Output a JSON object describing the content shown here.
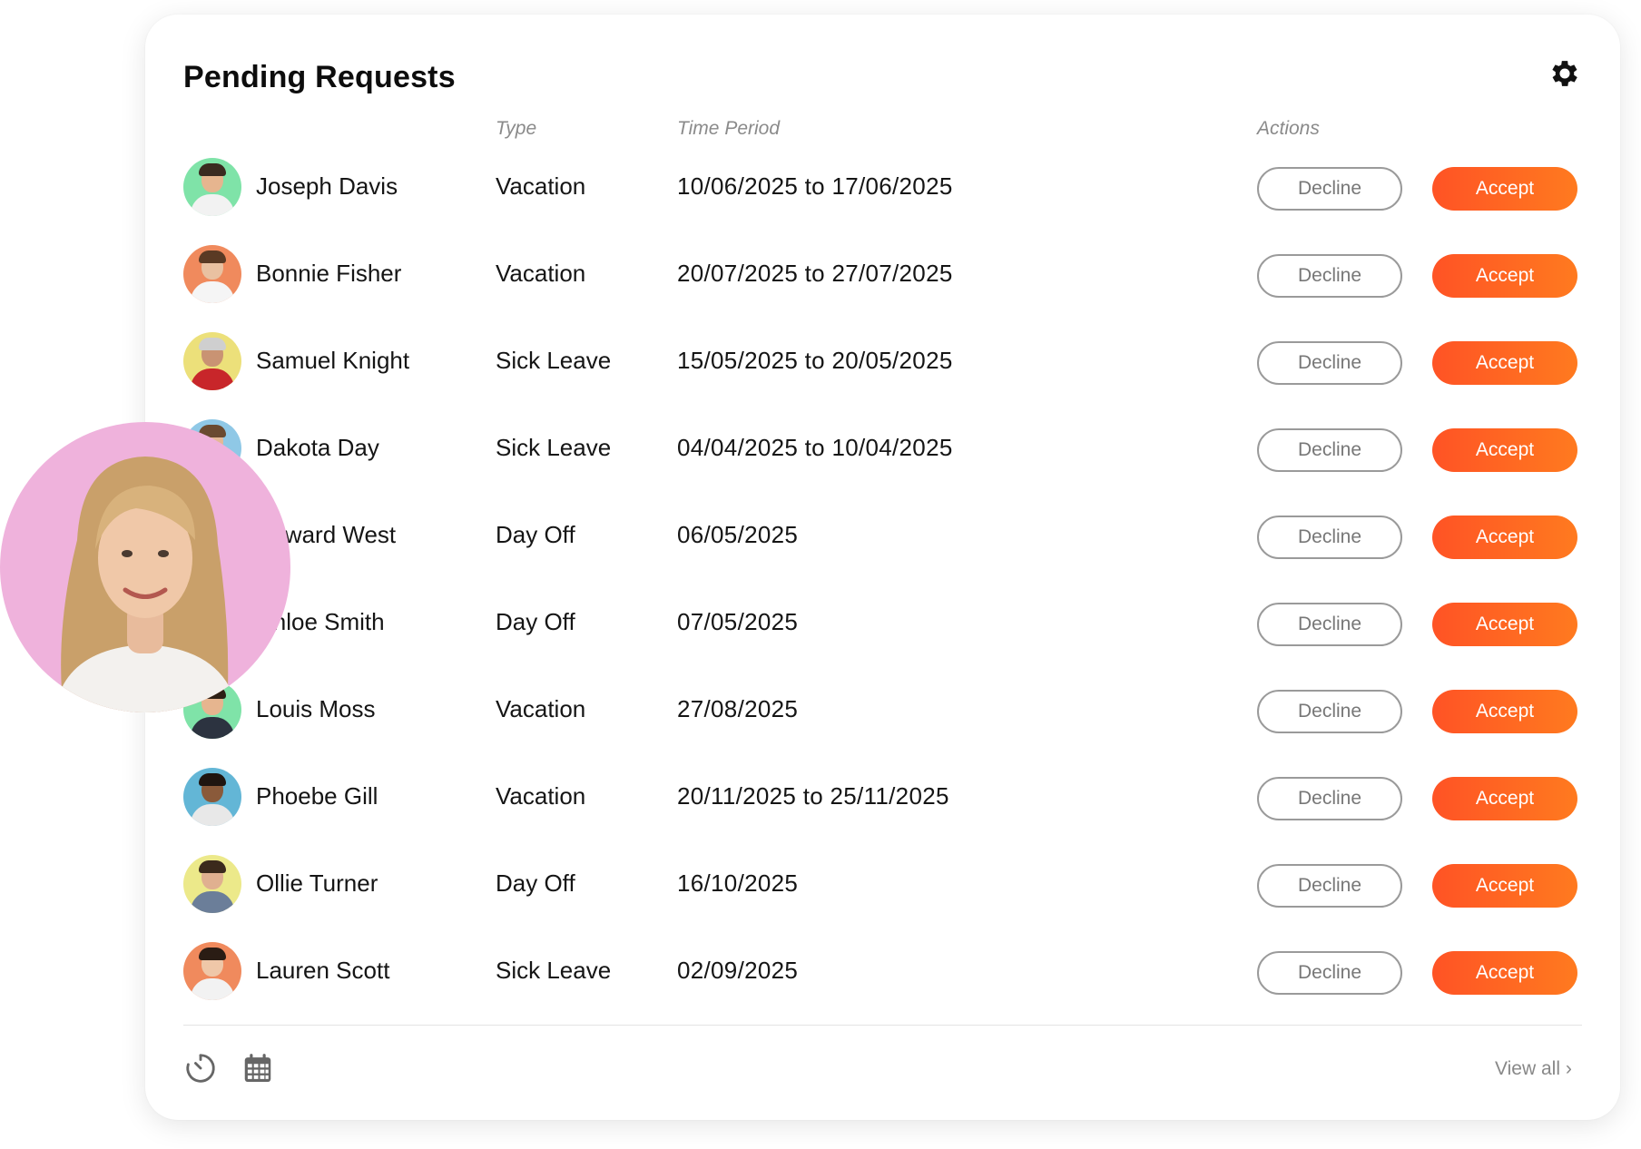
{
  "title": "Pending Requests",
  "columns": {
    "type": "Type",
    "period": "Time Period",
    "actions": "Actions"
  },
  "buttons": {
    "decline": "Decline",
    "accept": "Accept"
  },
  "rows": [
    {
      "name": "Joseph Davis",
      "type": "Vacation",
      "period": "10/06/2025 to 17/06/2025",
      "avatar_bg": "#7fe3a8",
      "skin": "#e6b58f",
      "hair": "#3a2a20",
      "shirt": "#f2f2f2"
    },
    {
      "name": "Bonnie Fisher",
      "type": "Vacation",
      "period": "20/07/2025 to 27/07/2025",
      "avatar_bg": "#f08a5d",
      "skin": "#e9c1a1",
      "hair": "#5a3a24",
      "shirt": "#f5f5f5"
    },
    {
      "name": "Samuel Knight",
      "type": "Sick Leave",
      "period": "15/05/2025 to 20/05/2025",
      "avatar_bg": "#ece07a",
      "skin": "#c99373",
      "hair": "#cfcfcf",
      "shirt": "#c8262a"
    },
    {
      "name": "Dakota Day",
      "type": "Sick Leave",
      "period": "04/04/2025 to 10/04/2025",
      "avatar_bg": "#8fc8e6",
      "skin": "#e4b896",
      "hair": "#6a4a30",
      "shirt": "#2b3f66"
    },
    {
      "name": "Edward West",
      "type": "Day Off",
      "period": "06/05/2025",
      "avatar_bg": "#f2c27a",
      "skin": "#dcae8c",
      "hair": "#3a2a20",
      "shirt": "#445566"
    },
    {
      "name": "Chloe Smith",
      "type": "Day Off",
      "period": "07/05/2025",
      "avatar_bg": "#b9e5a4",
      "skin": "#f0cdb0",
      "hair": "#a87a4a",
      "shirt": "#ffffff"
    },
    {
      "name": "Louis Moss",
      "type": "Vacation",
      "period": "27/08/2025",
      "avatar_bg": "#7fe3a8",
      "skin": "#e6b58f",
      "hair": "#2d2015",
      "shirt": "#2c3340"
    },
    {
      "name": "Phoebe Gill",
      "type": "Vacation",
      "period": "20/11/2025 to 25/11/2025",
      "avatar_bg": "#63b6d6",
      "skin": "#8a5a3a",
      "hair": "#1f1510",
      "shirt": "#e8e8e8"
    },
    {
      "name": "Ollie Turner",
      "type": "Day Off",
      "period": "16/10/2025",
      "avatar_bg": "#ece98a",
      "skin": "#e0b090",
      "hair": "#3b2a1c",
      "shirt": "#6b7e99"
    },
    {
      "name": "Lauren Scott",
      "type": "Sick Leave",
      "period": "02/09/2025",
      "avatar_bg": "#f08a5d",
      "skin": "#efc7a8",
      "hair": "#2a1c14",
      "shirt": "#f2f2f2"
    }
  ],
  "footer": {
    "view_all": "View all ›"
  },
  "icons": {
    "settings": "gear-icon",
    "history": "stopwatch-icon",
    "calendar": "calendar-icon"
  },
  "colors": {
    "accent": "#ff5325",
    "accent_end": "#ff7a1f",
    "featured_bg": "#efb2dc"
  }
}
